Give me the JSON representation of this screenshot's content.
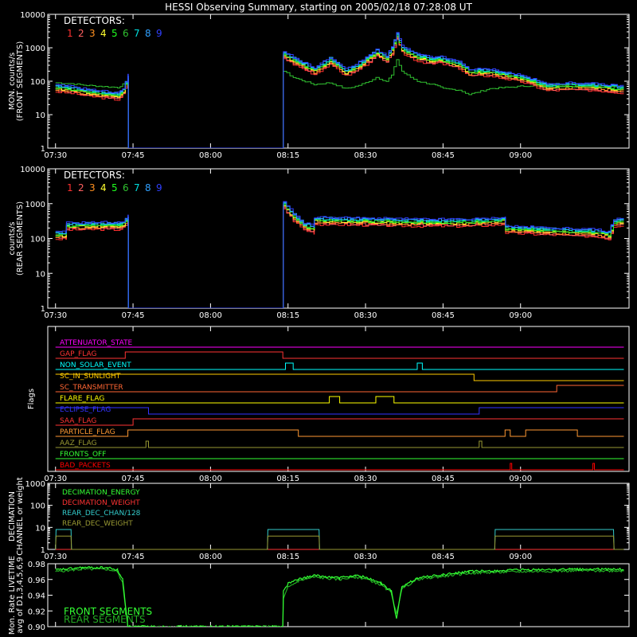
{
  "title": "HESSI Observing Summary, starting on 2005/02/18 07:28:08 UT",
  "colors": {
    "det": [
      "#ff3030",
      "#ff6060",
      "#ff9020",
      "#ffff30",
      "#20ff20",
      "#30c030",
      "#00e0e0",
      "#30a0ff",
      "#3040ff"
    ],
    "flag_palette": [
      "#ff00ff",
      "#ff3333",
      "#00ffff",
      "#ffcc00",
      "#ff6633",
      "#ffff00",
      "#3333ff",
      "#ff3333",
      "#ff9933",
      "#999933",
      "#33ff33",
      "#ff0000"
    ]
  },
  "time_ticks": [
    "07:30",
    "07:45",
    "08:00",
    "08:15",
    "08:30",
    "08:45",
    "09:00"
  ],
  "chart_data": [
    {
      "type": "line",
      "id": "front",
      "ylabel_line1": "MON. counts/s",
      "ylabel_line2": "(FRONT SEGMENTS)",
      "ylog": true,
      "ylim": [
        1,
        10000
      ],
      "yticks": [
        "1",
        "10",
        "100",
        "1000",
        "10000"
      ],
      "legend_title": "DETECTORS:",
      "legend_items": [
        "1",
        "2",
        "3",
        "4",
        "5",
        "6",
        "7",
        "8",
        "9"
      ],
      "x_minutes": [
        0,
        3,
        6,
        9,
        12,
        13,
        14,
        14.1,
        43.9,
        44,
        46,
        50,
        53,
        55,
        56,
        58,
        60,
        62,
        64,
        65,
        66,
        67,
        68,
        70,
        73,
        74,
        75,
        78,
        80,
        82,
        84,
        90,
        95,
        100,
        110,
        105,
        98
      ],
      "series": [
        {
          "name": "main",
          "x": [
            0,
            3,
            6,
            9,
            12,
            13,
            14,
            14.1,
            44,
            44.1,
            46,
            50,
            53,
            55,
            56,
            58,
            60,
            62,
            64,
            65,
            66,
            67,
            68,
            70,
            73,
            74,
            75,
            78,
            80,
            84,
            90,
            95,
            100,
            105,
            110
          ],
          "values": [
            60,
            55,
            45,
            40,
            35,
            50,
            120,
            1,
            1,
            600,
            400,
            200,
            400,
            250,
            180,
            250,
            400,
            700,
            450,
            800,
            2200,
            900,
            700,
            500,
            400,
            450,
            400,
            300,
            180,
            180,
            120,
            65,
            70,
            65,
            55
          ]
        },
        {
          "name": "det6",
          "x": [
            0,
            3,
            6,
            9,
            12,
            13,
            14,
            14.1,
            44,
            44.1,
            46,
            50,
            53,
            55,
            56,
            58,
            60,
            62,
            64,
            65,
            66,
            67,
            68,
            70,
            73,
            74,
            75,
            78,
            80,
            84,
            90,
            95,
            100,
            105,
            110
          ],
          "values": [
            90,
            85,
            75,
            70,
            65,
            80,
            100,
            1,
            1,
            200,
            130,
            80,
            90,
            70,
            60,
            70,
            90,
            130,
            100,
            150,
            450,
            200,
            150,
            100,
            80,
            70,
            60,
            55,
            40,
            60,
            70,
            80,
            80,
            75,
            70
          ]
        }
      ]
    },
    {
      "type": "line",
      "id": "rear",
      "ylabel_line1": "counts/s",
      "ylabel_line2": "(REAR SEGMENTS)",
      "ylog": true,
      "ylim": [
        1,
        10000
      ],
      "yticks": [
        "1",
        "10",
        "100",
        "1000",
        "10000"
      ],
      "legend_title": "DETECTORS:",
      "legend_items": [
        "1",
        "2",
        "3",
        "4",
        "5",
        "6",
        "7",
        "8",
        "9"
      ],
      "series": [
        {
          "name": "main",
          "x": [
            0,
            2,
            2.1,
            10,
            12,
            13,
            14,
            14.1,
            44,
            44.1,
            46,
            48,
            50,
            50.1,
            60,
            70,
            80,
            85,
            87,
            87.1,
            95,
            100,
            105,
            107,
            108,
            110
          ],
          "values": [
            120,
            120,
            220,
            230,
            220,
            250,
            350,
            1,
            1,
            900,
            400,
            220,
            180,
            320,
            300,
            280,
            280,
            300,
            330,
            180,
            160,
            150,
            140,
            120,
            280,
            300
          ]
        }
      ]
    },
    {
      "type": "table",
      "id": "flags",
      "ylabel": "Flags",
      "rows": [
        {
          "name": "ATTENUATOR_STATE",
          "color": "#ff00ff",
          "segments": [
            [
              0,
              110,
              0
            ]
          ]
        },
        {
          "name": "GAP_FLAG",
          "color": "#ff3333",
          "segments": [
            [
              0,
              13.5,
              0
            ],
            [
              13.5,
              44,
              1
            ],
            [
              44,
              110,
              0
            ]
          ]
        },
        {
          "name": "NON_SOLAR_EVENT",
          "color": "#00ffff",
          "segments": [
            [
              0,
              44.5,
              0
            ],
            [
              44.5,
              46,
              1
            ],
            [
              46,
              70,
              0
            ],
            [
              70,
              71,
              1
            ],
            [
              71,
              110,
              0
            ]
          ]
        },
        {
          "name": "SC_IN_SUNLIGHT",
          "color": "#ffcc00",
          "segments": [
            [
              0,
              14,
              1
            ],
            [
              14,
              81,
              1
            ],
            [
              81,
              110,
              0
            ]
          ]
        },
        {
          "name": "SC_TRANSMITTER",
          "color": "#ff6633",
          "segments": [
            [
              0,
              97,
              0
            ],
            [
              97,
              110,
              1
            ]
          ]
        },
        {
          "name": "FLARE_FLAG",
          "color": "#ffff00",
          "segments": [
            [
              0,
              53,
              0
            ],
            [
              53,
              55,
              1
            ],
            [
              55,
              62,
              0
            ],
            [
              62,
              65.5,
              1
            ],
            [
              65.5,
              110,
              0
            ]
          ]
        },
        {
          "name": "ECLIPSE_FLAG",
          "color": "#3333ff",
          "segments": [
            [
              0,
              18,
              1
            ],
            [
              18,
              82,
              0
            ],
            [
              82,
              110,
              1
            ]
          ]
        },
        {
          "name": "SAA_FLAG",
          "color": "#ff3333",
          "segments": [
            [
              0,
              15,
              0
            ],
            [
              15,
              110,
              1
            ]
          ]
        },
        {
          "name": "PARTICLE_FLAG",
          "color": "#ff9933",
          "segments": [
            [
              0,
              14,
              0
            ],
            [
              14,
              47,
              1
            ],
            [
              47,
              87,
              0
            ],
            [
              87,
              88,
              1
            ],
            [
              88,
              91,
              0
            ],
            [
              91,
              101,
              1
            ],
            [
              101,
              110,
              0
            ]
          ]
        },
        {
          "name": "AAZ_FLAG",
          "color": "#999933",
          "segments": [
            [
              0,
              17.5,
              0
            ],
            [
              17.5,
              18,
              1
            ],
            [
              18,
              82,
              0
            ],
            [
              82,
              82.5,
              1
            ],
            [
              82.5,
              110,
              0
            ]
          ]
        },
        {
          "name": "FRONTS_OFF",
          "color": "#33ff33",
          "segments": [
            [
              0,
              110,
              0
            ]
          ]
        },
        {
          "name": "BAD_PACKETS",
          "color": "#ff0000",
          "segments": [
            [
              0,
              88,
              0
            ],
            [
              88,
              88.3,
              1
            ],
            [
              88.3,
              104,
              0
            ],
            [
              104,
              104.3,
              1
            ],
            [
              104.3,
              110,
              0
            ]
          ]
        }
      ]
    },
    {
      "type": "line",
      "id": "decimation",
      "ylabel_line1": "DECIMATION",
      "ylabel_line2": "CHANNEL or weight",
      "ylog": true,
      "ylim": [
        1,
        1000
      ],
      "yticks": [
        "1",
        "10",
        "100",
        "1000"
      ],
      "series": [
        {
          "name": "DECIMATION_ENERGY",
          "color": "#33ff33",
          "x": [
            0,
            110
          ],
          "values": [
            1,
            1
          ]
        },
        {
          "name": "DECIMATION_WEIGHT",
          "color": "#ff3333",
          "x": [
            0,
            110
          ],
          "values": [
            1,
            1
          ]
        },
        {
          "name": "REAR_DEC_CHAN/128",
          "color": "#33cccc",
          "x": [
            0,
            0.1,
            3,
            3.1,
            41,
            41.1,
            51,
            51.1,
            85,
            85.1,
            108,
            108.1,
            110
          ],
          "values": [
            1,
            8,
            8,
            1,
            1,
            8,
            8,
            1,
            1,
            8,
            8,
            1,
            1
          ]
        },
        {
          "name": "REAR_DEC_WEIGHT",
          "color": "#999933",
          "x": [
            0,
            0.1,
            3,
            3.1,
            41,
            41.1,
            51,
            51.1,
            85,
            85.1,
            108,
            108.1,
            110
          ],
          "values": [
            1,
            4,
            4,
            1,
            1,
            4,
            4,
            1,
            1,
            4,
            4,
            1,
            1
          ]
        }
      ]
    },
    {
      "type": "line",
      "id": "livetime",
      "ylabel_line1": "Mon. Rate LIVETIME",
      "ylabel_line2": "avg of D1,3,4,5,6,9",
      "ylog": false,
      "ylim": [
        0.9,
        0.98
      ],
      "yticks": [
        "0.90",
        "0.92",
        "0.94",
        "0.96",
        "0.98"
      ],
      "series": [
        {
          "name": "FRONT SEGMENTS",
          "color": "#33ff33",
          "x": [
            0,
            5,
            10,
            12,
            13,
            14,
            14.1,
            44,
            44.1,
            45,
            47,
            50,
            55,
            58,
            60,
            63,
            65,
            66,
            67,
            70,
            75,
            80,
            90,
            100,
            110
          ],
          "values": [
            0.972,
            0.975,
            0.975,
            0.972,
            0.96,
            0.9,
            0.9,
            0.9,
            0.945,
            0.955,
            0.96,
            0.965,
            0.962,
            0.965,
            0.963,
            0.955,
            0.945,
            0.91,
            0.95,
            0.962,
            0.966,
            0.97,
            0.972,
            0.973,
            0.973
          ]
        },
        {
          "name": "REAR SEGMENTS",
          "color": "#22aa22",
          "x": [
            0,
            5,
            10,
            12,
            13,
            14,
            14.1,
            44,
            44.1,
            45,
            47,
            50,
            55,
            58,
            60,
            63,
            65,
            66,
            67,
            70,
            75,
            80,
            90,
            100,
            110
          ],
          "values": [
            0.97,
            0.973,
            0.973,
            0.97,
            0.955,
            0.9,
            0.9,
            0.9,
            0.935,
            0.95,
            0.958,
            0.963,
            0.96,
            0.963,
            0.961,
            0.953,
            0.943,
            0.915,
            0.948,
            0.96,
            0.964,
            0.968,
            0.97,
            0.971,
            0.971
          ]
        }
      ]
    }
  ]
}
